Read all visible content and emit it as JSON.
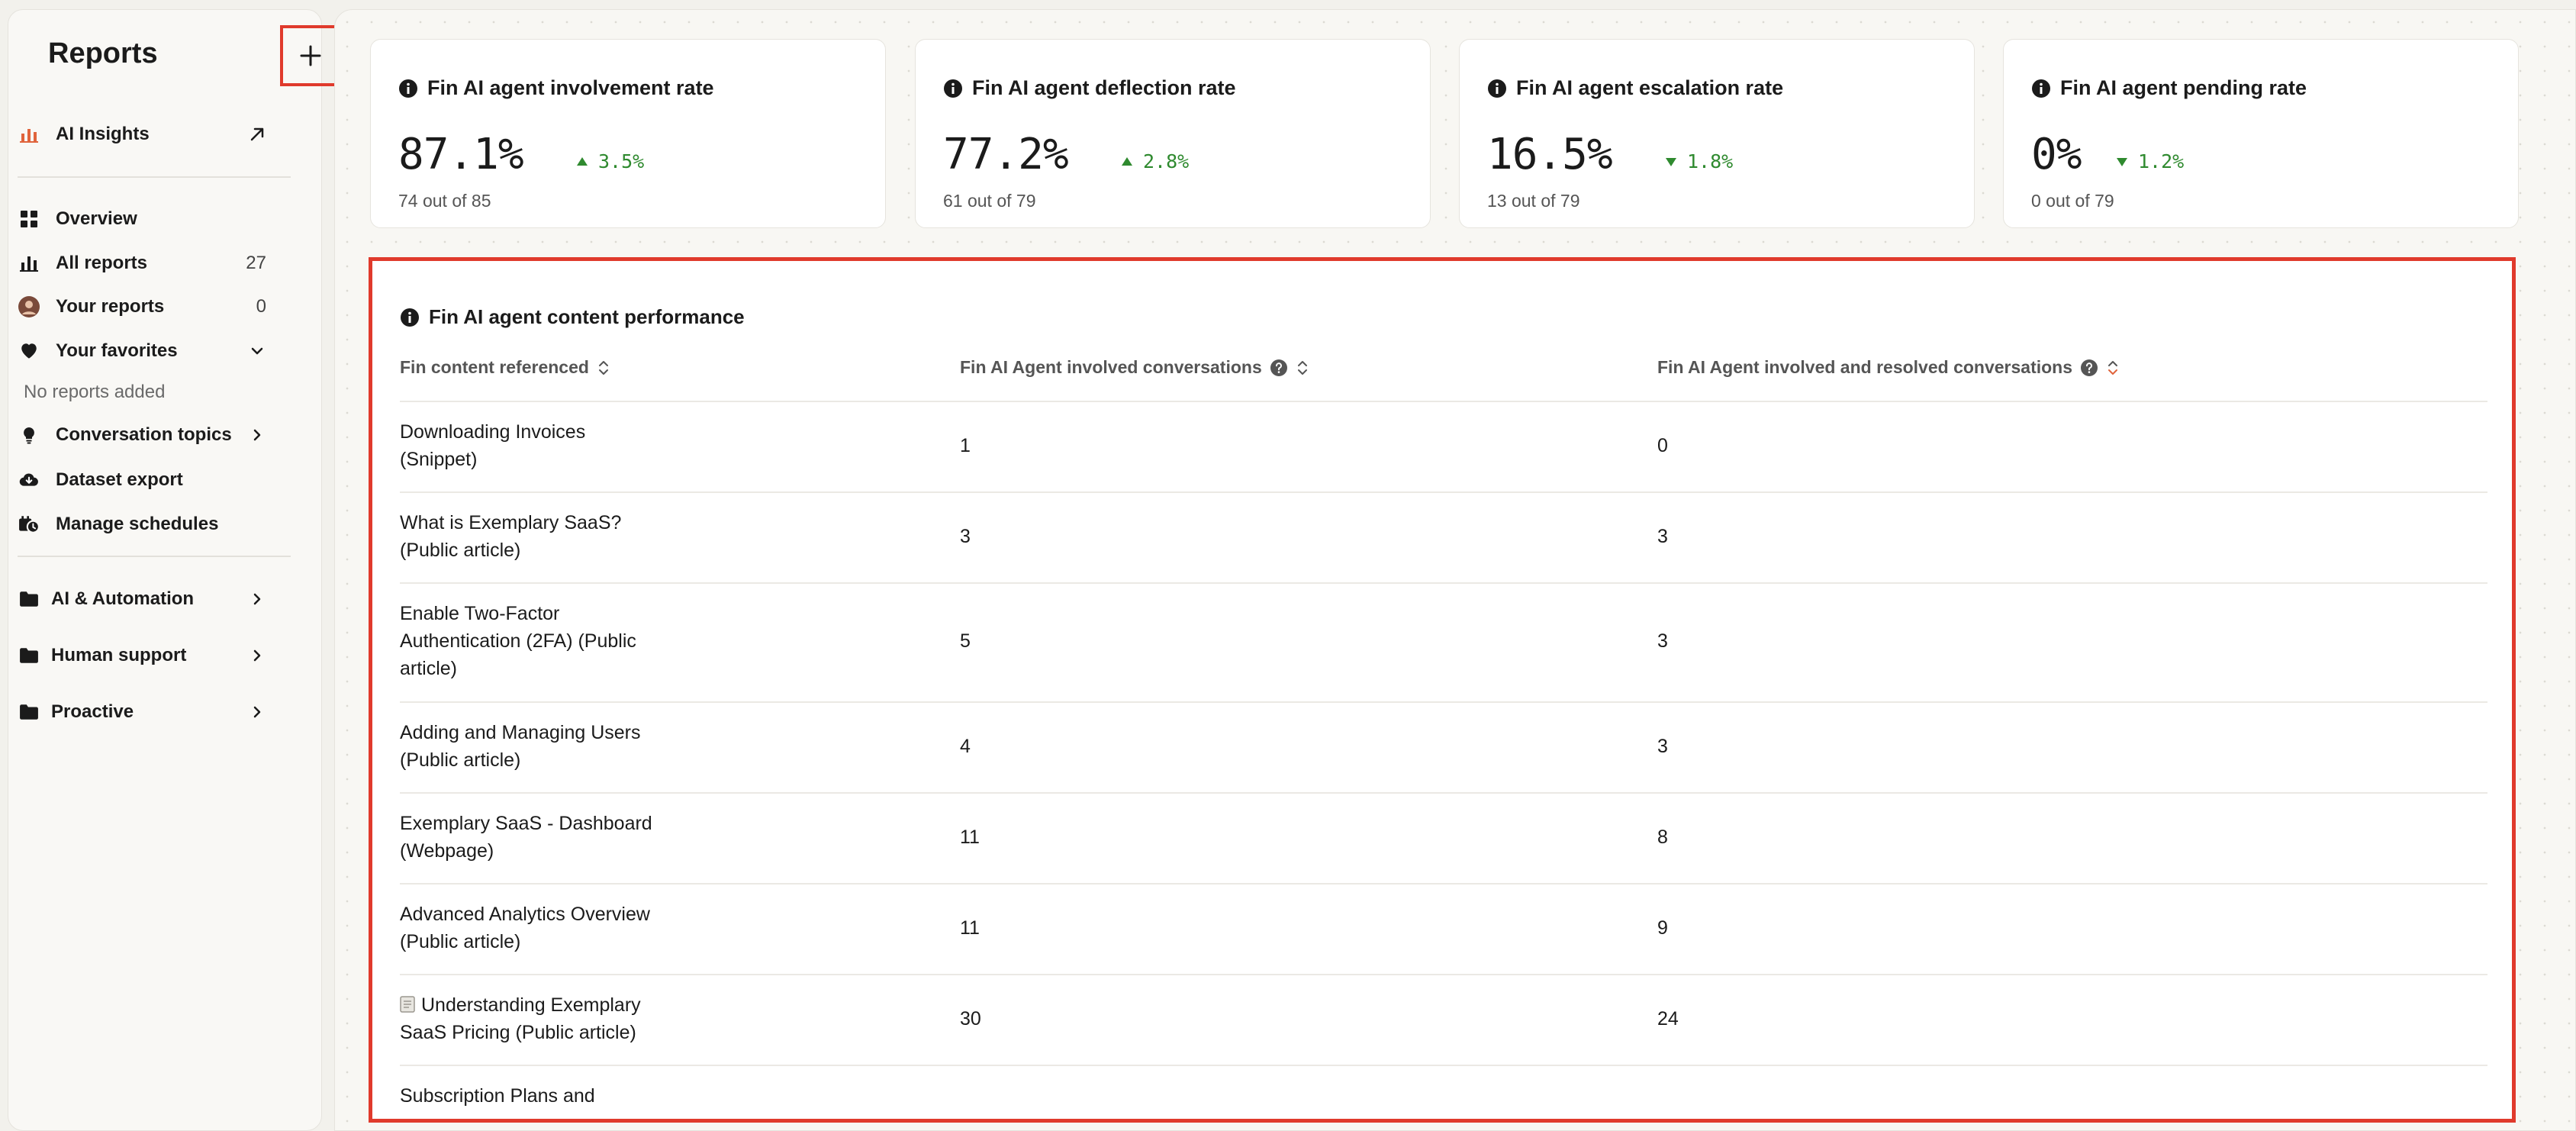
{
  "sidebar": {
    "title": "Reports",
    "items": [
      {
        "label": "AI Insights",
        "icon": "bar-chart-icon"
      },
      {
        "label": "Overview",
        "icon": "grid-icon"
      },
      {
        "label": "All reports",
        "icon": "bar-chart-icon",
        "count": "27"
      },
      {
        "label": "Your reports",
        "icon": "avatar",
        "count": "0"
      },
      {
        "label": "Your favorites",
        "icon": "heart-icon"
      },
      {
        "label": "Conversation topics",
        "icon": "lightbulb-icon"
      },
      {
        "label": "Dataset export",
        "icon": "cloud-download-icon"
      },
      {
        "label": "Manage schedules",
        "icon": "schedule-icon"
      }
    ],
    "favorites_empty": "No reports added",
    "folders": [
      {
        "label": "AI & Automation"
      },
      {
        "label": "Human support"
      },
      {
        "label": "Proactive"
      }
    ]
  },
  "metrics": [
    {
      "title": "Fin AI agent involvement rate",
      "value": "87.1%",
      "change": "3.5%",
      "direction": "up",
      "sub": "74 out of 85"
    },
    {
      "title": "Fin AI agent deflection rate",
      "value": "77.2%",
      "change": "2.8%",
      "direction": "up",
      "sub": "61 out of 79"
    },
    {
      "title": "Fin AI agent escalation rate",
      "value": "16.5%",
      "change": "1.8%",
      "direction": "down",
      "sub": "13 out of 79"
    },
    {
      "title": "Fin AI agent pending rate",
      "value": "0%",
      "change": "1.2%",
      "direction": "down",
      "sub": "0 out of 79"
    }
  ],
  "content_table": {
    "title": "Fin AI agent content performance",
    "columns": [
      "Fin content referenced",
      "Fin AI Agent involved conversations",
      "Fin AI Agent involved and resolved conversations"
    ],
    "rows": [
      {
        "content_l1": "Downloading Invoices",
        "content_l2": "(Snippet)",
        "content_l3": "",
        "involved": "1",
        "resolved": "0"
      },
      {
        "content_l1": "What is Exemplary SaaS?",
        "content_l2": "(Public article)",
        "content_l3": "",
        "involved": "3",
        "resolved": "3"
      },
      {
        "content_l1": "Enable Two-Factor",
        "content_l2": "Authentication (2FA) (Public",
        "content_l3": "article)",
        "involved": "5",
        "resolved": "3"
      },
      {
        "content_l1": "Adding and Managing Users",
        "content_l2": "(Public article)",
        "content_l3": "",
        "involved": "4",
        "resolved": "3"
      },
      {
        "content_l1": "Exemplary SaaS - Dashboard",
        "content_l2": "(Webpage)",
        "content_l3": "",
        "involved": "11",
        "resolved": "8"
      },
      {
        "content_l1": "Advanced Analytics Overview",
        "content_l2": "(Public article)",
        "content_l3": "",
        "involved": "11",
        "resolved": "9"
      },
      {
        "content_l1": "Understanding Exemplary",
        "content_l2": "SaaS Pricing (Public article)",
        "content_l3": "",
        "involved": "30",
        "resolved": "24"
      },
      {
        "content_l1": "Subscription Plans and",
        "content_l2": "",
        "content_l3": "",
        "involved": "",
        "resolved": ""
      }
    ]
  },
  "colors": {
    "accent_red": "#e03a2c",
    "positive_green": "#2f8a2f"
  }
}
